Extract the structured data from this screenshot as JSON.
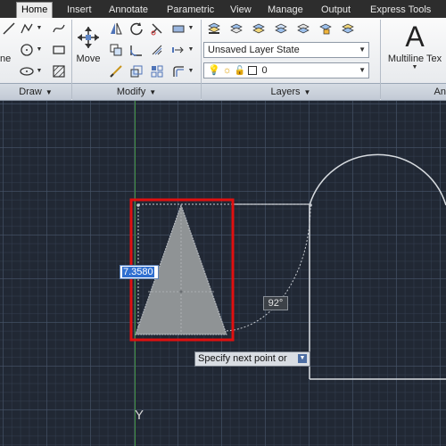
{
  "tabs": [
    {
      "label": "Home",
      "active": true
    },
    {
      "label": "Insert"
    },
    {
      "label": "Annotate"
    },
    {
      "label": "Parametric"
    },
    {
      "label": "View"
    },
    {
      "label": "Manage"
    },
    {
      "label": "Output"
    },
    {
      "label": "Express Tools"
    }
  ],
  "ribbon": {
    "draw_panel": {
      "title": "Draw",
      "partial_label": "ne"
    },
    "modify_panel": {
      "title": "Modify",
      "move_label": "Move"
    },
    "layers_panel": {
      "title": "Layers",
      "layer_state": "Unsaved Layer State",
      "current_layer": "0"
    },
    "annotation_panel": {
      "big_icon": "A",
      "multiline_text_label": "Multiline Tex",
      "partial_title": "An"
    }
  },
  "canvas": {
    "dynamic_input_value": "7.3580",
    "angle_tooltip": "92°",
    "command_prompt": "Specify next point or",
    "ucs_axis_label": "Y",
    "colors": {
      "background": "#212834",
      "triangle_fill": "#8f9395",
      "selection_box": "#e01010",
      "geometry": "#d8dce0",
      "ucs_y_axis": "#3f8f3f"
    }
  }
}
